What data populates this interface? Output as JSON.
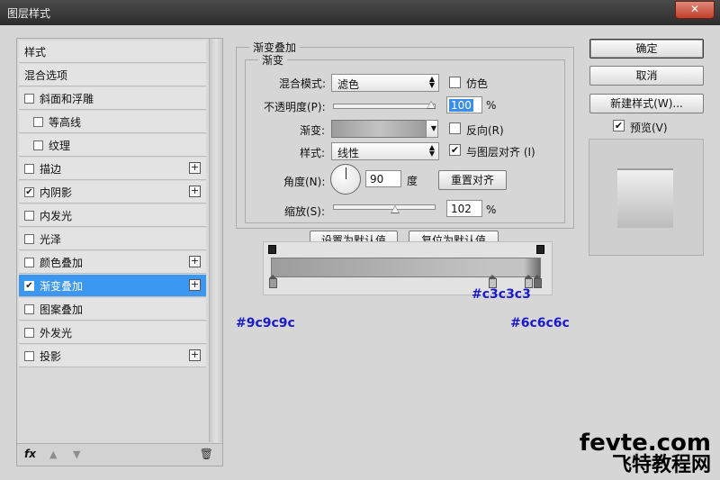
{
  "window": {
    "title": "图层样式",
    "close": "✕"
  },
  "sidebar": {
    "items": [
      {
        "label": "样式",
        "checkbox": false,
        "checked": false,
        "plus": false,
        "active": false,
        "indent": false
      },
      {
        "label": "混合选项",
        "checkbox": false,
        "checked": false,
        "plus": false,
        "active": false,
        "indent": false
      },
      {
        "label": "斜面和浮雕",
        "checkbox": true,
        "checked": false,
        "plus": false,
        "active": false,
        "indent": false
      },
      {
        "label": "等高线",
        "checkbox": true,
        "checked": false,
        "plus": false,
        "active": false,
        "indent": true
      },
      {
        "label": "纹理",
        "checkbox": true,
        "checked": false,
        "plus": false,
        "active": false,
        "indent": true
      },
      {
        "label": "描边",
        "checkbox": true,
        "checked": false,
        "plus": true,
        "active": false,
        "indent": false
      },
      {
        "label": "内阴影",
        "checkbox": true,
        "checked": true,
        "plus": true,
        "active": false,
        "indent": false
      },
      {
        "label": "内发光",
        "checkbox": true,
        "checked": false,
        "plus": false,
        "active": false,
        "indent": false
      },
      {
        "label": "光泽",
        "checkbox": true,
        "checked": false,
        "plus": false,
        "active": false,
        "indent": false
      },
      {
        "label": "颜色叠加",
        "checkbox": true,
        "checked": false,
        "plus": true,
        "active": false,
        "indent": false
      },
      {
        "label": "渐变叠加",
        "checkbox": true,
        "checked": true,
        "plus": true,
        "active": true,
        "indent": false
      },
      {
        "label": "图案叠加",
        "checkbox": true,
        "checked": false,
        "plus": false,
        "active": false,
        "indent": false
      },
      {
        "label": "外发光",
        "checkbox": true,
        "checked": false,
        "plus": false,
        "active": false,
        "indent": false
      },
      {
        "label": "投影",
        "checkbox": true,
        "checked": false,
        "plus": true,
        "active": false,
        "indent": false
      }
    ],
    "fx": "fx",
    "trash_icon": "trash-icon"
  },
  "panel": {
    "outer_title": "渐变叠加",
    "inner_title": "渐变",
    "blend_mode_label": "混合模式:",
    "blend_mode_value": "滤色",
    "dither_label": "仿色",
    "opacity_label": "不透明度(P):",
    "opacity_value": "100",
    "opacity_percent": 100,
    "percent": "%",
    "gradient_label": "渐变:",
    "reverse_label": "反向(R)",
    "style_label": "样式:",
    "style_value": "线性",
    "align_label": "与图层对齐 (I)",
    "angle_label": "角度(N):",
    "angle_value": "90",
    "angle_unit": "度",
    "reset_align": "重置对齐",
    "scale_label": "缩放(S):",
    "scale_value": "102",
    "scale_percent": 102,
    "set_default": "设置为默认值",
    "reset_default": "复位为默认值"
  },
  "gradient_notes": {
    "left": "#9c9c9c",
    "mid": "#c3c3c3",
    "right": "#6c6c6c"
  },
  "buttons": {
    "ok": "确定",
    "cancel": "取消",
    "new_style": "新建样式(W)...",
    "preview": "预览(V)"
  },
  "watermark": {
    "top": "fevte.com",
    "bottom": "飞特教程网"
  },
  "colors": {
    "active": "#3c97f2",
    "grad_left": "#9c9c9c",
    "grad_mid": "#c3c3c3",
    "grad_right": "#6c6c6c"
  }
}
